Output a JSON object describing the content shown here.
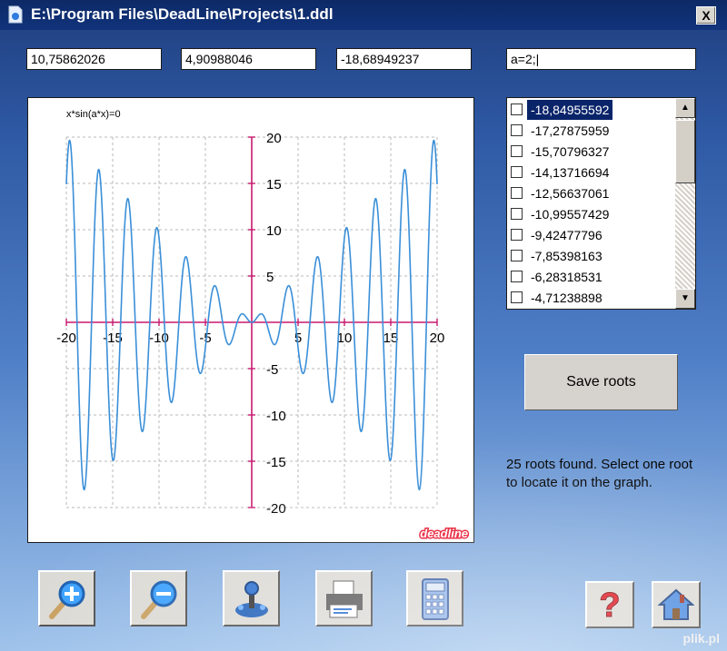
{
  "window": {
    "title": "E:\\Program Files\\DeadLine\\Projects\\1.ddl",
    "close_label": "X"
  },
  "fields": {
    "x_value": "10,75862026",
    "y_value": "4,90988046",
    "third_value": "-18,68949237",
    "expression": "a=2;|"
  },
  "graph": {
    "equation_label": "x*sin(a*x)=0",
    "brand": "deadline",
    "x_ticks": [
      "-20",
      "-15",
      "-10",
      "-5",
      "5",
      "10",
      "15",
      "20"
    ],
    "y_ticks": [
      "20",
      "15",
      "10",
      "5",
      "-5",
      "-10",
      "-15",
      "-20"
    ]
  },
  "chart_data": {
    "type": "line",
    "title": "x*sin(a*x)=0",
    "function": "x*sin(2*x)",
    "xlim": [
      -20,
      20
    ],
    "ylim": [
      -20,
      20
    ],
    "x_ticks": [
      -20,
      -15,
      -10,
      -5,
      5,
      10,
      15,
      20
    ],
    "y_ticks": [
      -20,
      -15,
      -10,
      -5,
      5,
      10,
      15,
      20
    ],
    "grid": true,
    "line_color": "#3a8fd8",
    "axis_color": "#c8186e"
  },
  "roots_list": {
    "items": [
      {
        "label": "-18,84955592",
        "checked": false,
        "selected": true
      },
      {
        "label": "-17,27875959",
        "checked": false
      },
      {
        "label": "-15,70796327",
        "checked": false
      },
      {
        "label": "-14,13716694",
        "checked": false
      },
      {
        "label": "-12,56637061",
        "checked": false
      },
      {
        "label": "-10,99557429",
        "checked": false
      },
      {
        "label": "-9,42477796",
        "checked": false
      },
      {
        "label": "-7,85398163",
        "checked": false
      },
      {
        "label": "-6,28318531",
        "checked": false
      },
      {
        "label": "-4,71238898",
        "checked": false
      }
    ]
  },
  "save_button_label": "Save roots",
  "status_text": "25 roots found. Select one root to locate it on the graph.",
  "toolbar": [
    {
      "name": "zoom-in-icon"
    },
    {
      "name": "zoom-out-icon"
    },
    {
      "name": "joystick-icon"
    },
    {
      "name": "printer-icon"
    },
    {
      "name": "calculator-icon"
    },
    {
      "name": "help-icon"
    },
    {
      "name": "home-icon"
    }
  ],
  "watermark": "plik.pl"
}
